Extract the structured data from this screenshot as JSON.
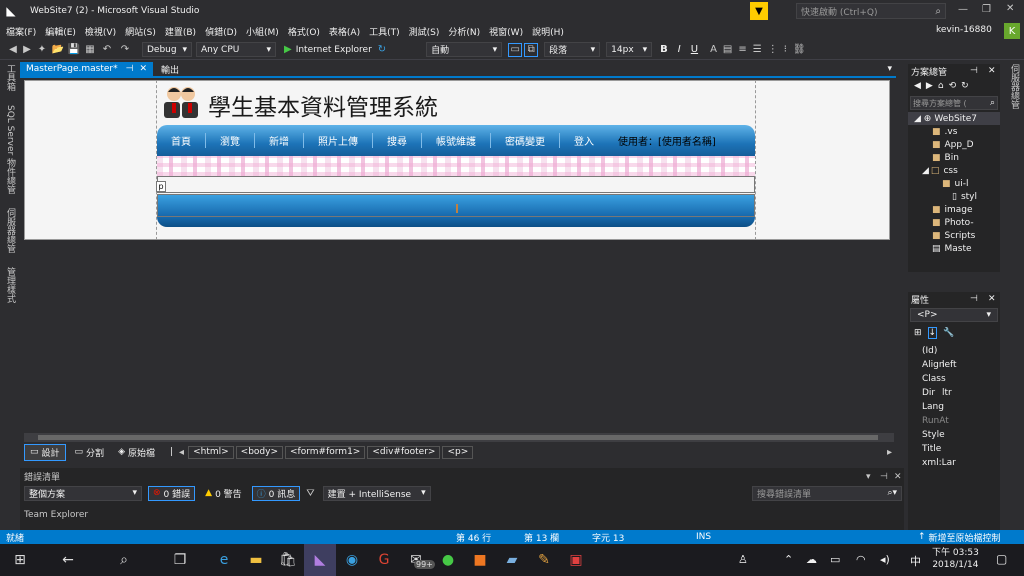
{
  "window": {
    "title": "WebSite7 (2) - Microsoft Visual Studio",
    "quick_launch": "快速啟動 (Ctrl+Q)",
    "user": "kevin-16880",
    "user_initial": "K"
  },
  "menu": [
    "檔案(F)",
    "編輯(E)",
    "檢視(V)",
    "網站(S)",
    "建置(B)",
    "偵錯(D)",
    "小組(M)",
    "格式(O)",
    "表格(A)",
    "工具(T)",
    "測試(S)",
    "分析(N)",
    "視窗(W)",
    "說明(H)"
  ],
  "toolbar": {
    "config": "Debug",
    "platform": "Any CPU",
    "browser": "Internet Explorer",
    "position": "自動",
    "block": "段落",
    "font_size": "14px",
    "bold": "B",
    "italic": "I",
    "underline": "U"
  },
  "left_rail": [
    "工具箱",
    "SQL Server 物件總管",
    "伺服器總管",
    "管理樣式"
  ],
  "tabs": {
    "active": "MasterPage.master*",
    "second": "輸出"
  },
  "page": {
    "title": "學生基本資料管理系統",
    "nav": [
      "首頁",
      "瀏覽",
      "新增",
      "照片上傳",
      "搜尋",
      "帳號維護",
      "密碼變更",
      "登入"
    ],
    "user_label": "使用者：[使用者名稱]",
    "p_tag": "p"
  },
  "view_bar": {
    "design": "設計",
    "split": "分割",
    "source": "原始檔",
    "breadcrumbs": [
      "<html>",
      "<body>",
      "<form#form1>",
      "<div#footer>",
      "<p>"
    ]
  },
  "error_list": {
    "header": "錯誤清單",
    "scope": "整個方案",
    "errors": "0 錯誤",
    "warnings": "0 警告",
    "messages": "0 訊息",
    "build": "建置 + IntelliSense",
    "search": "搜尋錯誤清單"
  },
  "team_explorer": "Team Explorer",
  "solution_explorer": {
    "title": "方案總管",
    "search": "搜尋方案總管 (",
    "items": [
      "WebSite7",
      ".vs",
      "App_D",
      "Bin",
      "css",
      "ui-l",
      "styl",
      "image",
      "Photo-",
      "Scripts",
      "Maste"
    ]
  },
  "properties": {
    "title": "屬性",
    "selector": "<P>",
    "rows": [
      {
        "k": "(Id)",
        "v": ""
      },
      {
        "k": "Align",
        "v": "left"
      },
      {
        "k": "Class",
        "v": ""
      },
      {
        "k": "Dir",
        "v": "ltr"
      },
      {
        "k": "Lang",
        "v": ""
      },
      {
        "k": "RunAt",
        "v": ""
      },
      {
        "k": "Style",
        "v": ""
      },
      {
        "k": "Title",
        "v": ""
      },
      {
        "k": "xml:Lar",
        "v": ""
      }
    ]
  },
  "right_rail": "伺服器總管",
  "status": {
    "ready": "就緒",
    "line": "第 46 行",
    "col": "第 13 欄",
    "char": "字元 13",
    "ins": "INS",
    "publish": "新增至原始檔控制"
  },
  "taskbar": {
    "time": "下午 03:53",
    "date": "2018/1/14",
    "ime": "中",
    "badge": "99+"
  }
}
